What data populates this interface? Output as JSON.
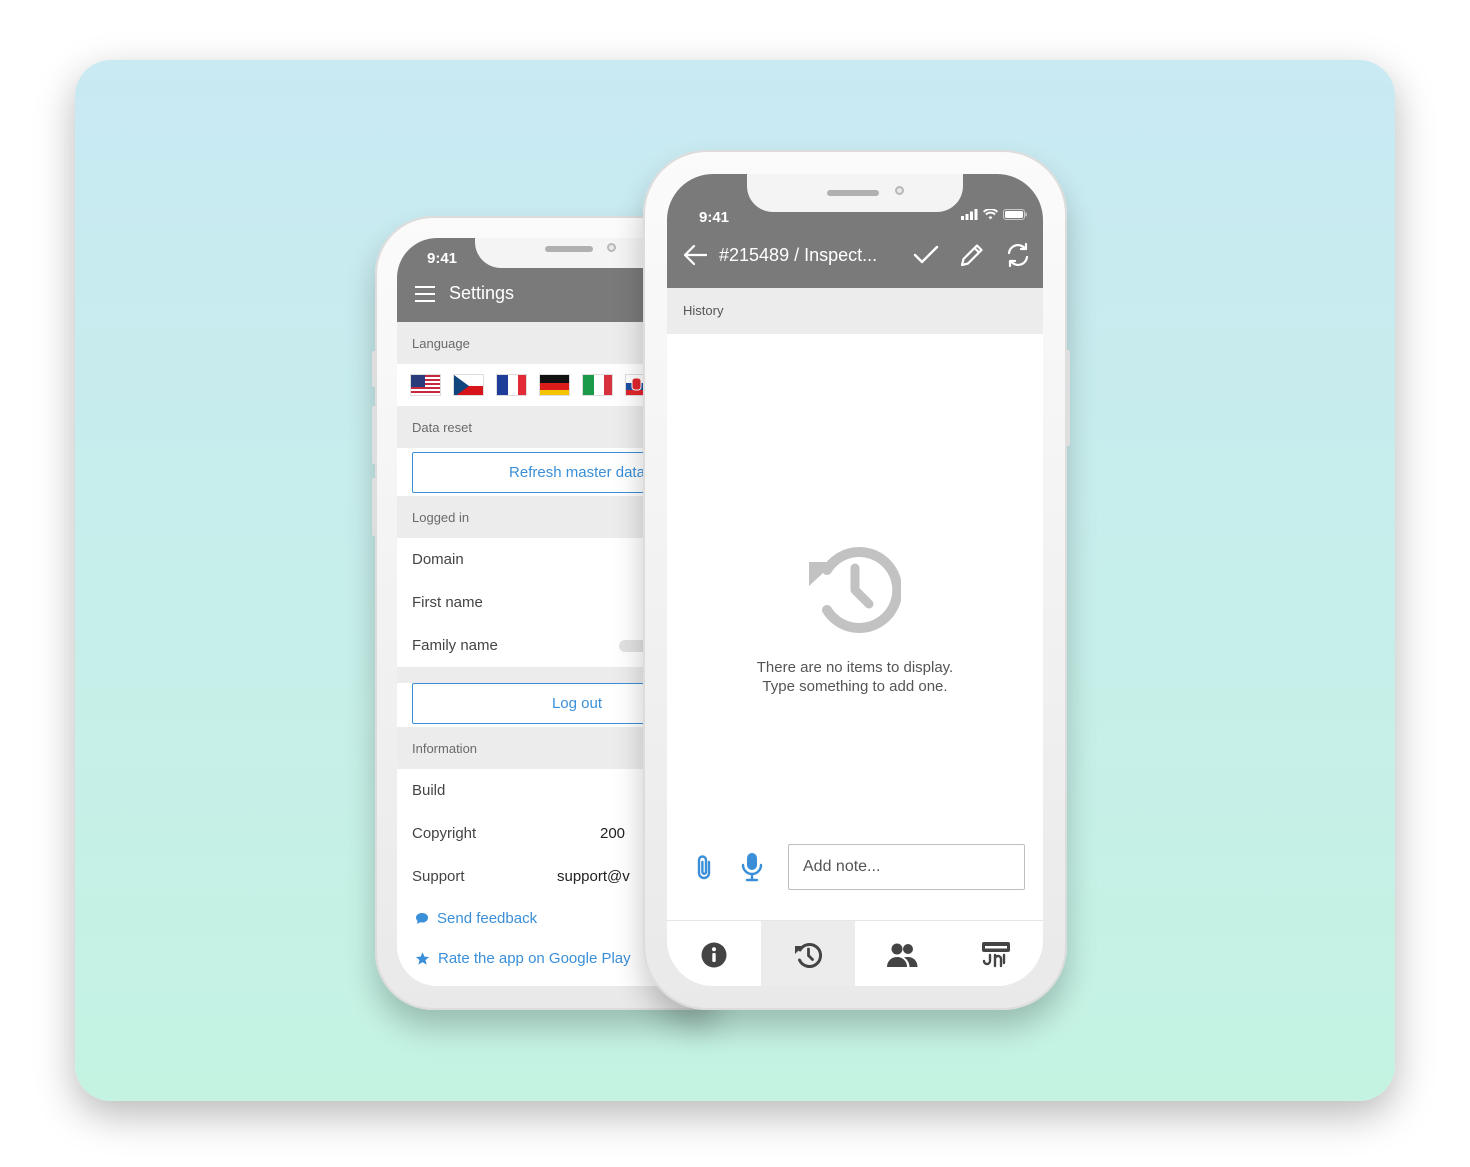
{
  "settings_screen": {
    "status_time": "9:41",
    "title": "Settings",
    "sections": {
      "language": "Language",
      "data_reset": "Data reset",
      "logged_in": "Logged in",
      "information": "Information"
    },
    "flags": [
      "us-flag",
      "cz-flag",
      "fr-flag",
      "de-flag",
      "it-flag",
      "sk-flag"
    ],
    "refresh_button": "Refresh master data",
    "rows_logged_in": [
      "Domain",
      "First name",
      "Family name"
    ],
    "logout_button": "Log out",
    "info_rows": [
      {
        "label": "Build",
        "value": ""
      },
      {
        "label": "Copyright",
        "value": "200"
      },
      {
        "label": "Support",
        "value": "support@v"
      }
    ],
    "links": {
      "feedback": "Send feedback",
      "rate": "Rate the app on Google Play"
    }
  },
  "history_screen": {
    "status_time": "9:41",
    "title": "#215489 / Inspect...",
    "section": "History",
    "empty_line1": "There are no items to display.",
    "empty_line2": "Type something to add one.",
    "note_placeholder": "Add note...",
    "tabs": [
      "info-icon",
      "history-icon",
      "people-icon",
      "inspection-icon"
    ],
    "active_tab": "history-icon"
  },
  "colors": {
    "appbar": "#7a7a7a",
    "accent": "#3a8fd8",
    "section_bg": "#ececec",
    "background_top": "#c9e9f3",
    "background_bottom": "#c4f3e2"
  }
}
